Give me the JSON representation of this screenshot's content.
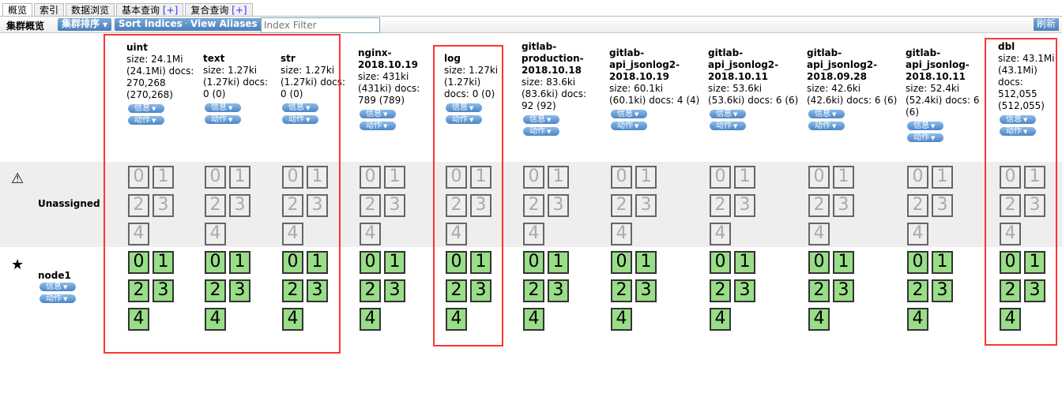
{
  "tabs": [
    {
      "label": "概览"
    },
    {
      "label": "索引"
    },
    {
      "label": "数据浏览"
    },
    {
      "label": "基本查询",
      "plus": "[+]"
    },
    {
      "label": "复合查询",
      "plus": "[+]"
    }
  ],
  "toolbar": {
    "title": "集群概览",
    "sort_cluster": "集群排序",
    "sort_indices": "Sort Indices",
    "view_aliases": "View Aliases",
    "filter_placeholder": "Index Filter",
    "refresh": "刷新"
  },
  "menu": {
    "info": "信息",
    "actions": "动作"
  },
  "rows": {
    "unassigned": "Unassigned",
    "node": "node1"
  },
  "shards": [
    "0",
    "1",
    "2",
    "3",
    "4"
  ],
  "indices": [
    {
      "name": "uint",
      "size": "24.1Mi",
      "size_total": "(24.1Mi)",
      "docs": "270,268",
      "docs_total": "(270,268)"
    },
    {
      "name": "text",
      "size": "1.27ki",
      "size_total": "(1.27ki)",
      "docs": "0",
      "docs_total": "(0)"
    },
    {
      "name": "str",
      "size": "1.27ki",
      "size_total": "(1.27ki)",
      "docs": "0",
      "docs_total": "(0)"
    },
    {
      "name": "nginx-2018.10.19",
      "size": "431ki",
      "size_total": "(431ki)",
      "docs": "789",
      "docs_total": "(789)"
    },
    {
      "name": "log",
      "size": "1.27ki",
      "size_total": "(1.27ki)",
      "docs": "0",
      "docs_total": "(0)"
    },
    {
      "name": "gitlab-production-2018.10.18",
      "size": "83.6ki",
      "size_total": "(83.6ki)",
      "docs": "92",
      "docs_total": "(92)"
    },
    {
      "name": "gitlab-api_jsonlog2-2018.10.19",
      "size": "60.1ki",
      "size_total": "(60.1ki)",
      "docs": "4",
      "docs_total": "(4)"
    },
    {
      "name": "gitlab-api_jsonlog2-2018.10.11",
      "size": "53.6ki",
      "size_total": "(53.6ki)",
      "docs": "6",
      "docs_total": "(6)"
    },
    {
      "name": "gitlab-api_jsonlog2-2018.09.28",
      "size": "42.6ki",
      "size_total": "(42.6ki)",
      "docs": "6",
      "docs_total": "(6)"
    },
    {
      "name": "gitlab-api_jsonlog-2018.10.11",
      "size": "52.4ki",
      "size_total": "(52.4ki)",
      "docs": "6",
      "docs_total": "(6)"
    },
    {
      "name": "dbl",
      "size": "43.1Mi",
      "size_total": "(43.1Mi)",
      "docs": "512,055",
      "docs_total": "(512,055)"
    }
  ]
}
